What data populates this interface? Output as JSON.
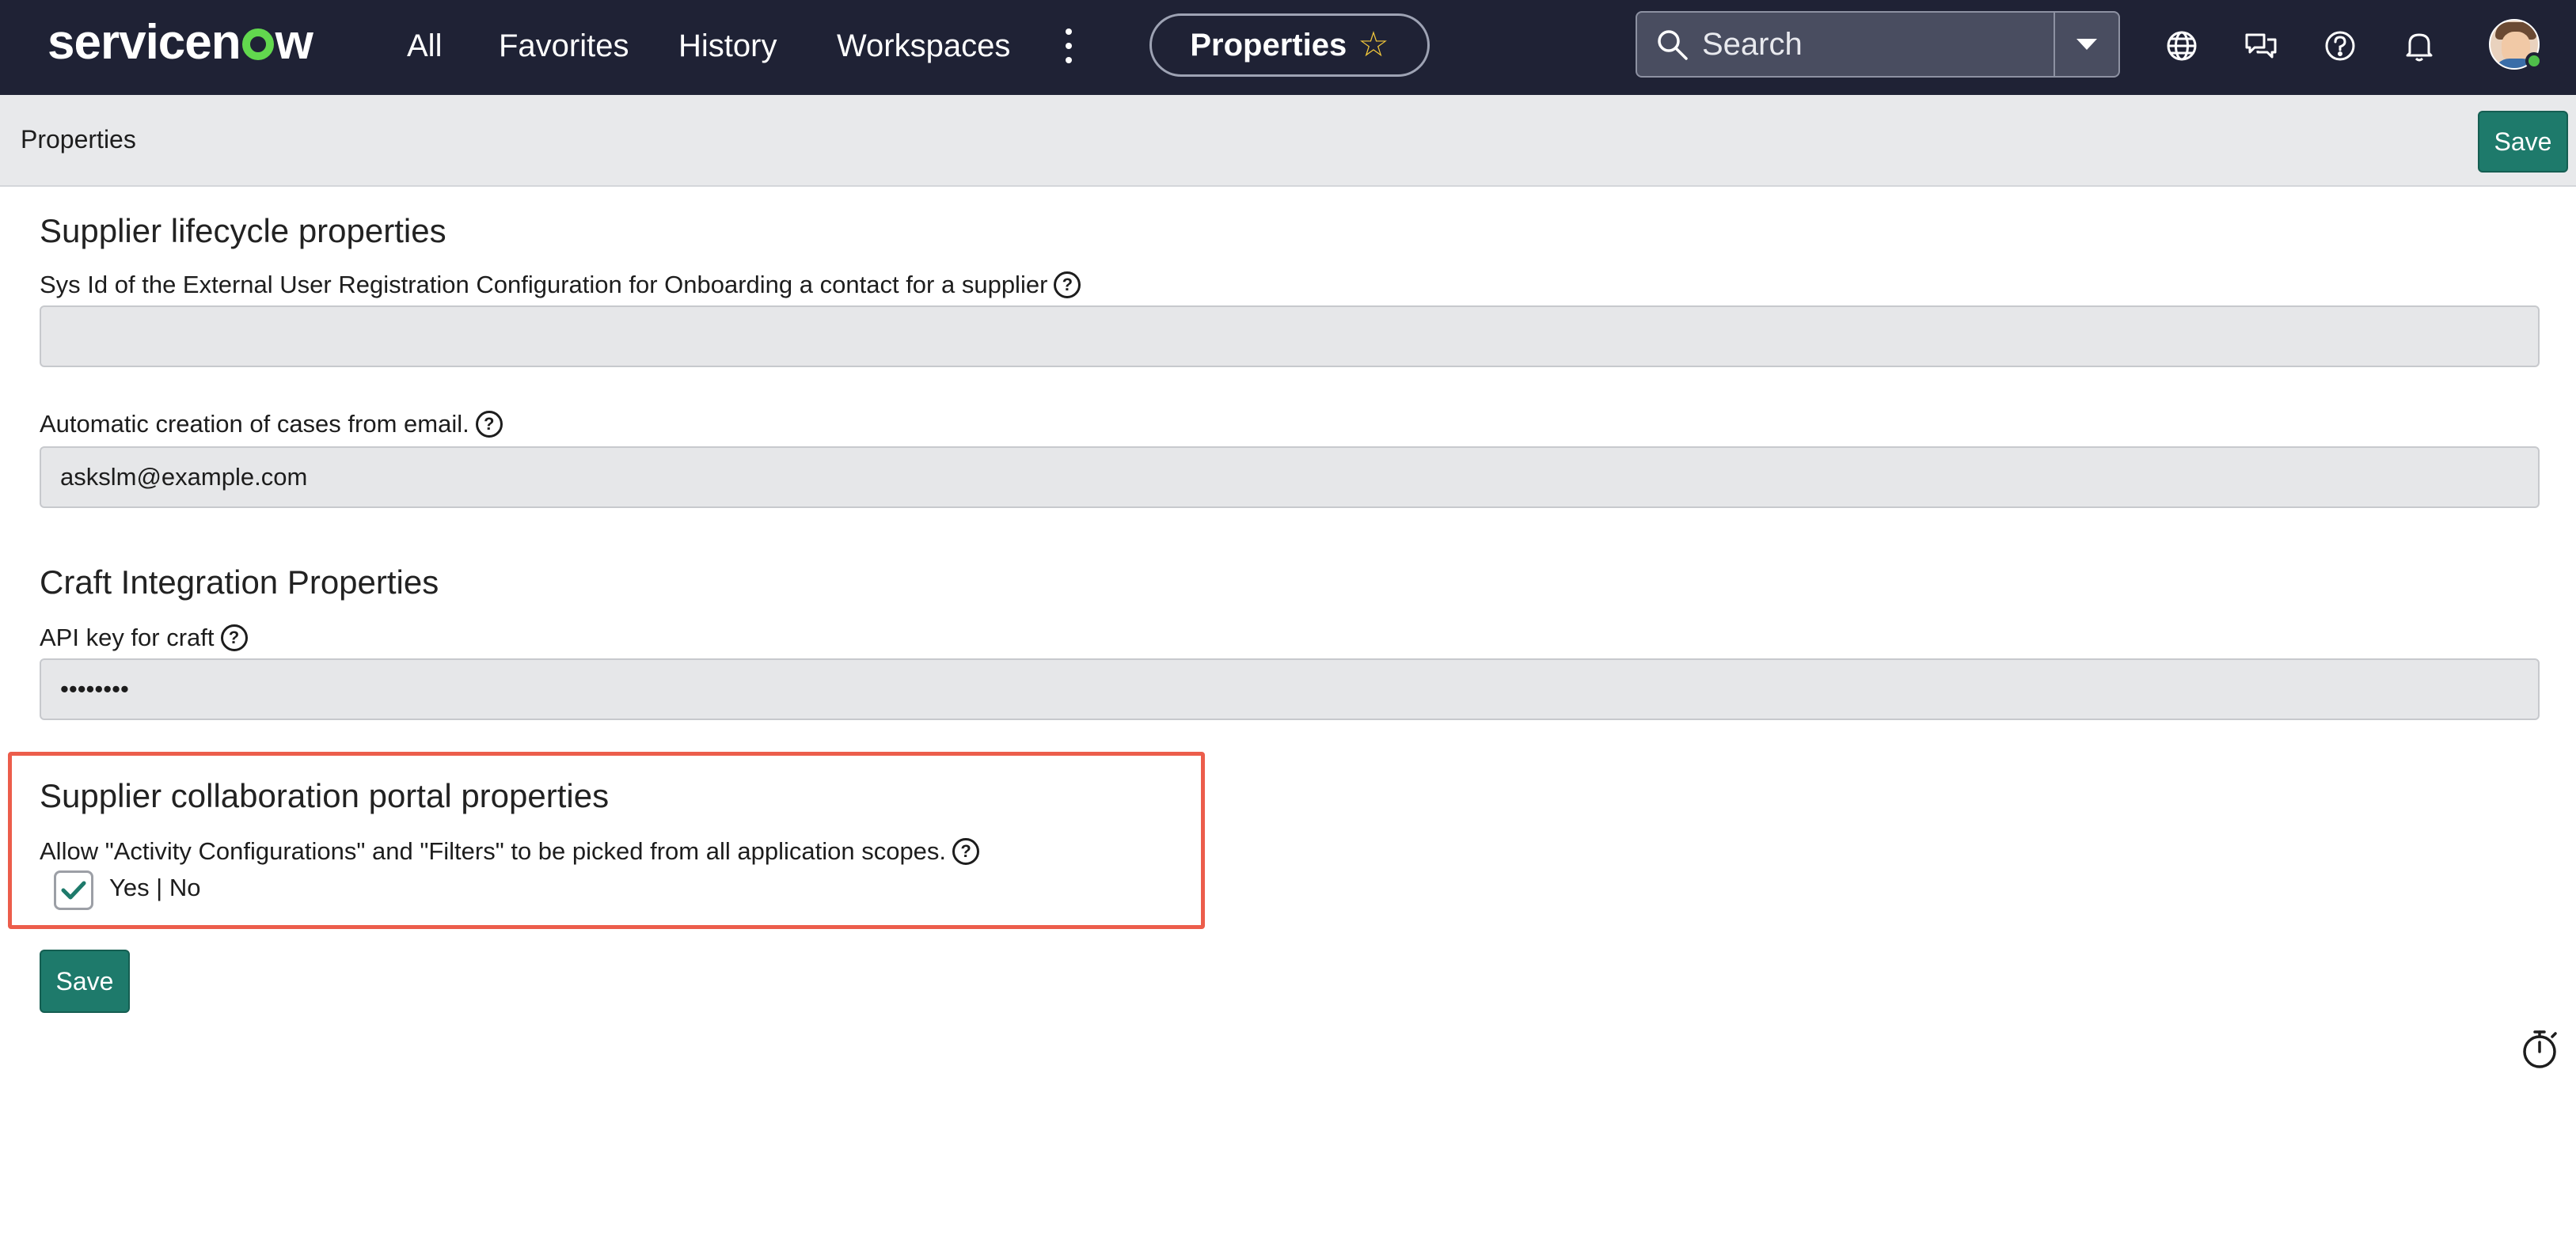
{
  "nav": {
    "logo": "servicenow",
    "links": [
      "All",
      "Favorites",
      "History",
      "Workspaces"
    ],
    "context_pill": "Properties",
    "search_placeholder": "Search",
    "icons": [
      "more-vertical-icon",
      "star-icon",
      "search-icon",
      "chevron-down-icon",
      "globe-icon",
      "chat-icon",
      "help-icon",
      "bell-icon",
      "user-avatar"
    ]
  },
  "subheader": {
    "title": "Properties",
    "save_label": "Save"
  },
  "sections": [
    {
      "title": "Supplier lifecycle properties",
      "fields": [
        {
          "label": "Sys Id of the External User Registration Configuration for Onboarding a contact for a supplier",
          "value": ""
        },
        {
          "label": "Automatic creation of cases from email.",
          "value": "askslm@example.com"
        }
      ]
    },
    {
      "title": "Craft Integration Properties",
      "fields": [
        {
          "label": "API key for craft",
          "value": "••••••••"
        }
      ]
    },
    {
      "title": "Supplier collaboration portal properties",
      "fields": [
        {
          "label": "Allow \"Activity Configurations\" and \"Filters\" to be picked from all application scopes.",
          "checked": true,
          "option_text": "Yes | No"
        }
      ]
    }
  ],
  "footer": {
    "save_label": "Save"
  },
  "colors": {
    "nav_bg": "#1f2235",
    "accent_save": "#1e7a6b",
    "highlight_border": "#ec5d4b",
    "logo_o": "#62d84e"
  }
}
